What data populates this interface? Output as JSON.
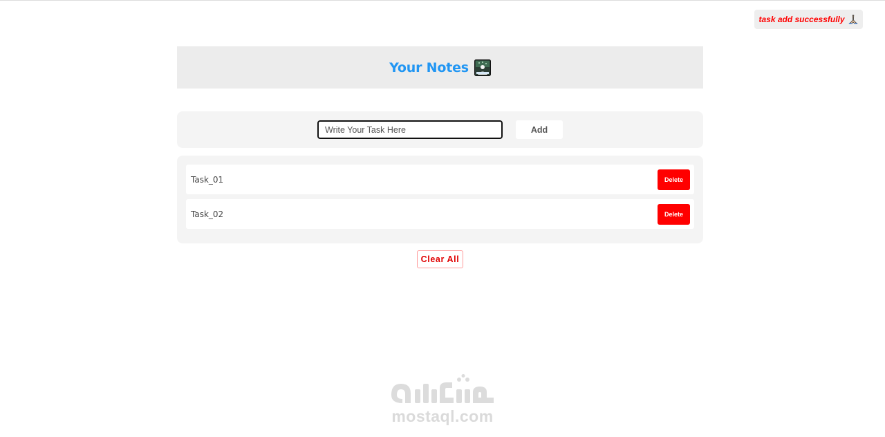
{
  "toast": {
    "message": "task add successfully",
    "icon": "folded-hands-icon",
    "color": "#ff0000"
  },
  "header": {
    "title": "Your Notes",
    "title_color": "#2196f3",
    "icon": "notes-icon"
  },
  "input": {
    "placeholder": "Write Your Task Here",
    "value": ""
  },
  "add_button": {
    "label": "Add"
  },
  "tasks": [
    {
      "text": "Task_01",
      "delete_label": "Delete"
    },
    {
      "text": "Task_02",
      "delete_label": "Delete"
    }
  ],
  "clear_button": {
    "label": "Clear All",
    "color": "#e00000"
  },
  "watermark": {
    "logo_text": "مستقل",
    "site": "mostaql.com"
  }
}
